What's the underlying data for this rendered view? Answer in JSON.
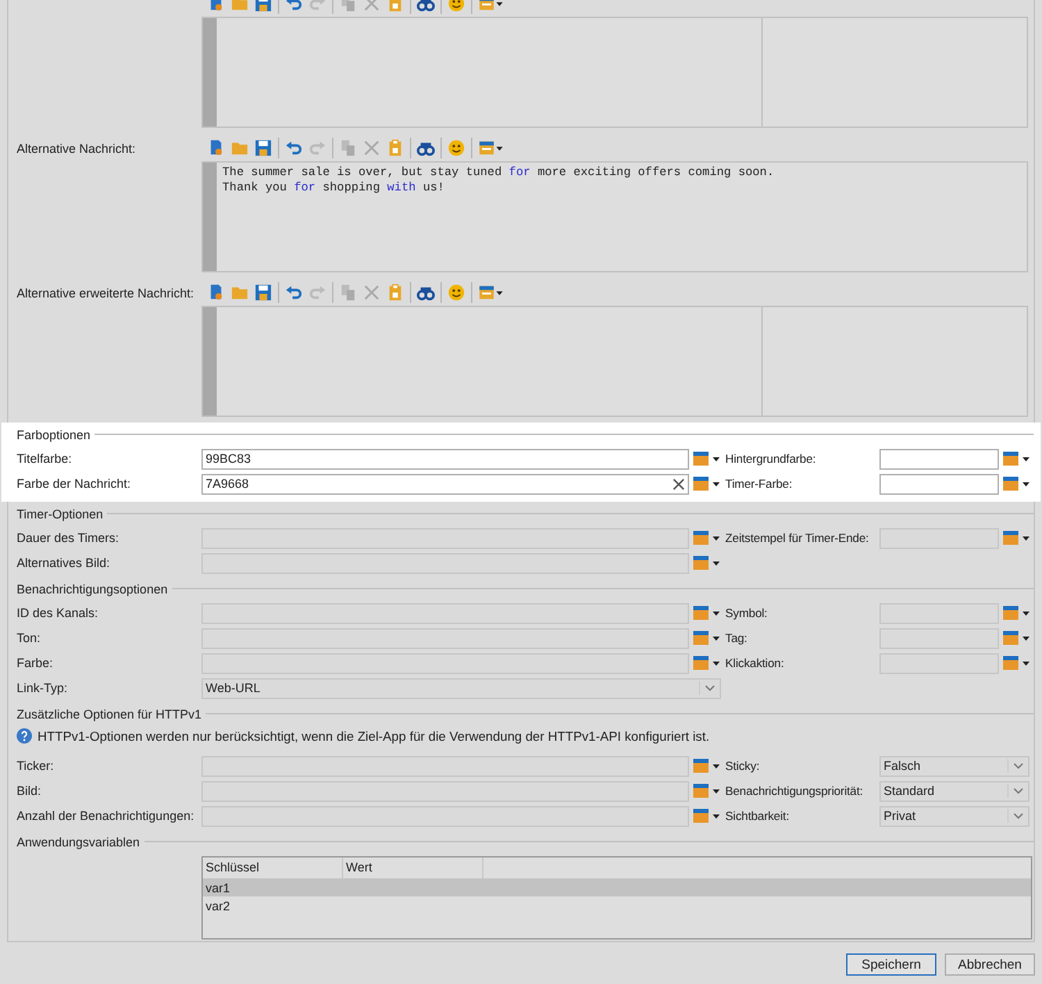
{
  "editors": [
    {
      "split": true
    },
    {
      "label": "Alternative Nachricht:",
      "split": false,
      "lines": [
        [
          {
            "text": "The summer sale is over, but stay tuned ",
            "kind": "plain"
          },
          {
            "text": "for",
            "kind": "keyword"
          },
          {
            "text": " more exciting offers coming soon.",
            "kind": "plain"
          }
        ],
        [
          {
            "text": "Thank you ",
            "kind": "plain"
          },
          {
            "text": "for",
            "kind": "keyword"
          },
          {
            "text": " shopping ",
            "kind": "plain"
          },
          {
            "text": "with",
            "kind": "keyword"
          },
          {
            "text": " us!",
            "kind": "plain"
          }
        ]
      ]
    },
    {
      "label": "Alternative erweiterte Nachricht:",
      "split": true
    }
  ],
  "sections": [
    {
      "title": "Farboptionen",
      "highlighted": true,
      "rows": [
        {
          "label": "Titelfarbe:",
          "field": {
            "kind": "text",
            "value": "99BC83"
          },
          "right": {
            "label": "Hintergrundfarbe:",
            "field": {
              "kind": "text"
            }
          }
        },
        {
          "label": "Farbe der Nachricht:",
          "field": {
            "kind": "text",
            "value": "7A9668",
            "clearable": true
          },
          "right": {
            "label": "Timer-Farbe:",
            "field": {
              "kind": "text"
            }
          }
        }
      ]
    },
    {
      "title": "Timer-Optionen",
      "highlighted": false,
      "rows": [
        {
          "label": "Dauer des Timers:",
          "field": {
            "kind": "text",
            "clearable": false
          },
          "right": {
            "label": "Zeitstempel für Timer-Ende:",
            "field": {
              "kind": "text"
            }
          }
        },
        {
          "label": "Alternatives Bild:",
          "field": {
            "kind": "text",
            "clearable": false
          }
        }
      ]
    },
    {
      "title": "Benachrichtigungsoptionen",
      "highlighted": false,
      "rows": [
        {
          "label": "ID des Kanals:",
          "field": {
            "kind": "text",
            "clearable": false
          },
          "right": {
            "label": "Symbol:",
            "field": {
              "kind": "text"
            }
          }
        },
        {
          "label": "Ton:",
          "field": {
            "kind": "text",
            "clearable": false
          },
          "right": {
            "label": "Tag:",
            "field": {
              "kind": "text"
            }
          }
        },
        {
          "label": "Farbe:",
          "field": {
            "kind": "text",
            "clearable": false
          },
          "right": {
            "label": "Klickaktion:",
            "field": {
              "kind": "text"
            }
          }
        },
        {
          "label": "Link-Typ:",
          "field": {
            "kind": "select",
            "value": "Web-URL"
          }
        }
      ]
    },
    {
      "title": "Zusätzliche Optionen für HTTPv1",
      "highlighted": false,
      "info": "HTTPv1-Optionen werden nur berücksichtigt, wenn die Ziel-App für die Verwendung der HTTPv1-API konfiguriert ist.",
      "rows": [
        {
          "label": "Ticker:",
          "field": {
            "kind": "text",
            "clearable": false
          },
          "right": {
            "label": "Sticky:",
            "field": {
              "kind": "select",
              "value": "Falsch"
            }
          }
        },
        {
          "label": "Bild:",
          "field": {
            "kind": "text",
            "clearable": false
          },
          "right": {
            "label": "Benachrichtigungspriorität:",
            "field": {
              "kind": "select",
              "value": "Standard"
            }
          }
        },
        {
          "label": "Anzahl der Benachrichtigungen:",
          "field": {
            "kind": "text",
            "clearable": false
          },
          "right": {
            "label": "Sichtbarkeit:",
            "field": {
              "kind": "select",
              "value": "Privat"
            }
          }
        }
      ]
    },
    {
      "title": "Anwendungsvariablen",
      "highlighted": false,
      "table": {
        "columns": [
          "Schlüssel",
          "Wert"
        ],
        "rows": [
          {
            "cells": [
              "var1"
            ],
            "selected": true
          },
          {
            "cells": [
              "var2"
            ],
            "selected": false
          }
        ]
      }
    }
  ],
  "buttons": [
    {
      "label": "Speichern",
      "primary": true
    },
    {
      "label": "Abbrechen",
      "primary": false
    }
  ]
}
